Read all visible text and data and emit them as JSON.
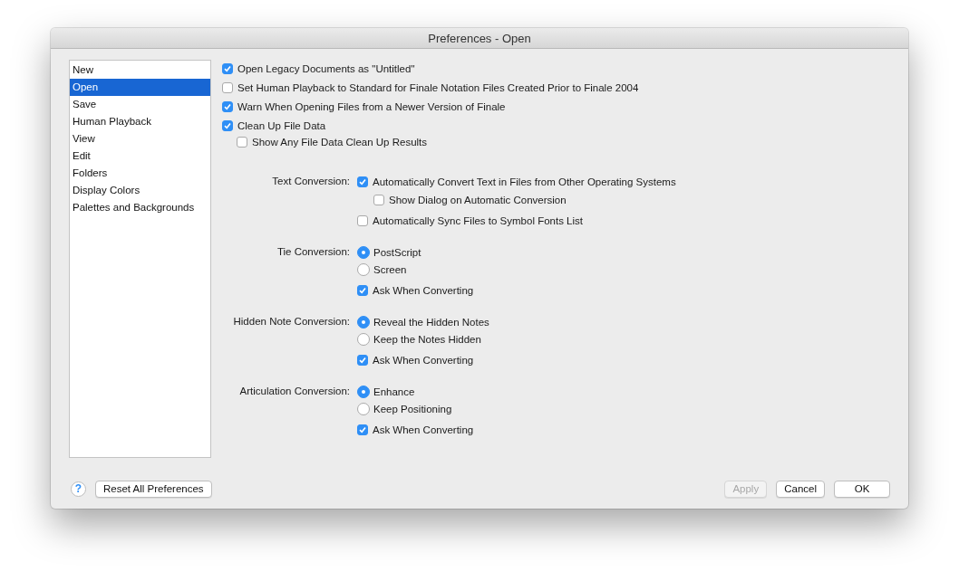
{
  "window": {
    "title": "Preferences - Open"
  },
  "sidebar": {
    "items": [
      {
        "label": "New",
        "selected": false
      },
      {
        "label": "Open",
        "selected": true
      },
      {
        "label": "Save",
        "selected": false
      },
      {
        "label": "Human Playback",
        "selected": false
      },
      {
        "label": "View",
        "selected": false
      },
      {
        "label": "Edit",
        "selected": false
      },
      {
        "label": "Folders",
        "selected": false
      },
      {
        "label": "Display Colors",
        "selected": false
      },
      {
        "label": "Palettes and Backgrounds",
        "selected": false
      }
    ]
  },
  "options": [
    {
      "label": "Open Legacy Documents as \"Untitled\"",
      "checked": true
    },
    {
      "label": "Set Human Playback to Standard for Finale Notation Files Created Prior to Finale 2004",
      "checked": false
    },
    {
      "label": "Warn When Opening Files from a Newer Version of Finale",
      "checked": true
    },
    {
      "label": "Clean Up File Data",
      "checked": true,
      "children": [
        {
          "label": "Show Any File Data Clean Up Results",
          "checked": false
        }
      ]
    }
  ],
  "sections": [
    {
      "label": "Text Conversion:",
      "options": [
        {
          "kind": "checkbox",
          "label": "Automatically Convert Text in Files from Other Operating Systems",
          "checked": true,
          "children": [
            {
              "label": "Show Dialog on Automatic Conversion",
              "checked": false
            }
          ]
        },
        {
          "kind": "checkbox",
          "label": "Automatically Sync Files to Symbol Fonts List",
          "checked": false
        }
      ]
    },
    {
      "label": "Tie Conversion:",
      "options": [
        {
          "kind": "radio",
          "label": "PostScript",
          "selected": true
        },
        {
          "kind": "radio",
          "label": "Screen",
          "selected": false
        },
        {
          "kind": "checkbox",
          "label": "Ask When Converting",
          "checked": true
        }
      ]
    },
    {
      "label": "Hidden Note Conversion:",
      "options": [
        {
          "kind": "radio",
          "label": "Reveal the Hidden Notes",
          "selected": true
        },
        {
          "kind": "radio",
          "label": "Keep the Notes Hidden",
          "selected": false
        },
        {
          "kind": "checkbox",
          "label": "Ask When Converting",
          "checked": true
        }
      ]
    },
    {
      "label": "Articulation Conversion:",
      "options": [
        {
          "kind": "radio",
          "label": "Enhance",
          "selected": true
        },
        {
          "kind": "radio",
          "label": "Keep Positioning",
          "selected": false
        },
        {
          "kind": "checkbox",
          "label": "Ask When Converting",
          "checked": true
        }
      ]
    }
  ],
  "footer": {
    "help": "?",
    "left_buttons": [
      {
        "label": "Reset All Preferences",
        "disabled": false
      }
    ],
    "right_buttons": [
      {
        "label": "Apply",
        "disabled": true
      },
      {
        "label": "Cancel",
        "disabled": false
      },
      {
        "label": "OK",
        "disabled": false
      }
    ]
  }
}
